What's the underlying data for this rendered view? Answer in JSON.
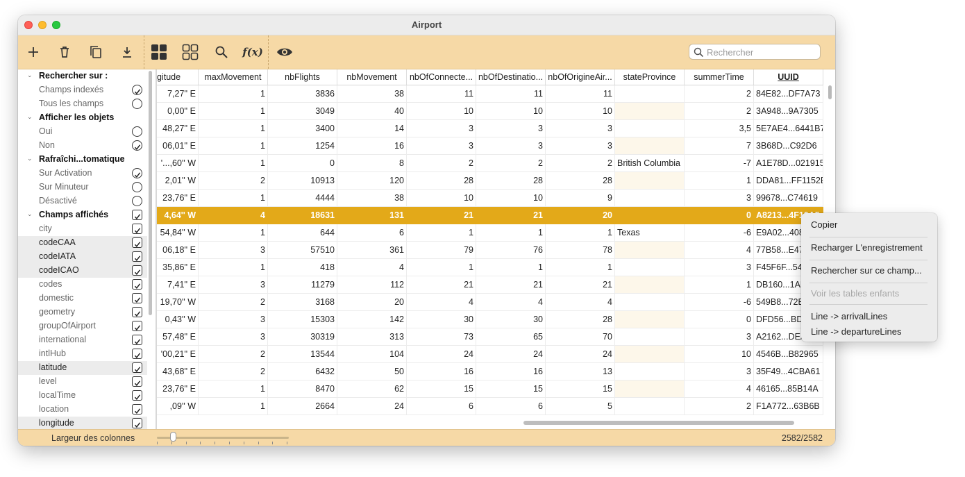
{
  "window": {
    "title": "Airport"
  },
  "toolbar": {
    "icons": [
      "plus-icon",
      "trash-icon",
      "duplicate-icon",
      "download-icon",
      "grid-view-icon",
      "grid-outline-icon",
      "magnifier-icon",
      "function-icon",
      "eye-icon"
    ],
    "search_placeholder": "Rechercher",
    "function_label": "f(x)"
  },
  "sidebar": {
    "sections": [
      {
        "title": "Rechercher sur :",
        "items": [
          {
            "label": "Champs indexés",
            "type": "radio",
            "checked": true
          },
          {
            "label": "Tous les champs",
            "type": "radio",
            "checked": false
          }
        ]
      },
      {
        "title": "Afficher les objets",
        "items": [
          {
            "label": "Oui",
            "type": "radio",
            "checked": false
          },
          {
            "label": "Non",
            "type": "radio",
            "checked": true
          }
        ]
      },
      {
        "title": "Rafraîchi...tomatique",
        "items": [
          {
            "label": "Sur Activation",
            "type": "radio",
            "checked": true
          },
          {
            "label": "Sur Minuteur",
            "type": "radio",
            "checked": false
          },
          {
            "label": "Désactivé",
            "type": "radio",
            "checked": false
          }
        ]
      },
      {
        "title": "Champs affichés",
        "checkbox": true,
        "items": [
          {
            "label": "city",
            "type": "check",
            "checked": true
          },
          {
            "label": "codeCAA",
            "type": "check",
            "checked": true,
            "highlight": true
          },
          {
            "label": "codeIATA",
            "type": "check",
            "checked": true,
            "highlight": true
          },
          {
            "label": "codeICAO",
            "type": "check",
            "checked": true,
            "highlight": true
          },
          {
            "label": "codes",
            "type": "check",
            "checked": true
          },
          {
            "label": "domestic",
            "type": "check",
            "checked": true
          },
          {
            "label": "geometry",
            "type": "check",
            "checked": true
          },
          {
            "label": "groupOfAirport",
            "type": "check",
            "checked": true
          },
          {
            "label": "international",
            "type": "check",
            "checked": true
          },
          {
            "label": "intlHub",
            "type": "check",
            "checked": true
          },
          {
            "label": "latitude",
            "type": "check",
            "checked": true,
            "highlight": true
          },
          {
            "label": "level",
            "type": "check",
            "checked": true
          },
          {
            "label": "localTime",
            "type": "check",
            "checked": true
          },
          {
            "label": "location",
            "type": "check",
            "checked": true
          },
          {
            "label": "longitude",
            "type": "check",
            "checked": true,
            "highlight": true
          }
        ]
      }
    ]
  },
  "table": {
    "columns": [
      "gitude",
      "maxMovement",
      "nbFlights",
      "nbMovement",
      "nbOfConnecte...",
      "nbOfDestinatio...",
      "nbOfOrigineAir...",
      "stateProvince",
      "summerTime",
      "UUID"
    ],
    "sorted_column": "UUID",
    "selected_row": 7,
    "rows": [
      [
        "7,27'' E",
        "1",
        "3836",
        "38",
        "11",
        "11",
        "11",
        "",
        "2",
        "84E82...DF7A73"
      ],
      [
        "0,00'' E",
        "1",
        "3049",
        "40",
        "10",
        "10",
        "10",
        "",
        "2",
        "3A948...9A7305"
      ],
      [
        "48,27'' E",
        "1",
        "3400",
        "14",
        "3",
        "3",
        "3",
        "",
        "3,5",
        "5E7AE4...6441B7"
      ],
      [
        "06,01'' E",
        "1",
        "1254",
        "16",
        "3",
        "3",
        "3",
        "",
        "7",
        "3B68D...C92D6"
      ],
      [
        "'...,60'' W",
        "1",
        "0",
        "8",
        "2",
        "2",
        "2",
        "British Columbia",
        "-7",
        "A1E78D...021915"
      ],
      [
        "2,01'' W",
        "2",
        "10913",
        "120",
        "28",
        "28",
        "28",
        "",
        "1",
        "DDA81...FF1152E"
      ],
      [
        "23,76'' E",
        "1",
        "4444",
        "38",
        "10",
        "10",
        "9",
        "",
        "3",
        "99678...C74619"
      ],
      [
        "4,64'' W",
        "4",
        "18631",
        "131",
        "21",
        "21",
        "20",
        "",
        "0",
        "A8213...4F10A5"
      ],
      [
        "54,84'' W",
        "1",
        "644",
        "6",
        "1",
        "1",
        "1",
        "Texas",
        "-6",
        "E9A02...408"
      ],
      [
        "06,18'' E",
        "3",
        "57510",
        "361",
        "79",
        "76",
        "78",
        "",
        "4",
        "77B58...E47"
      ],
      [
        "35,86'' E",
        "1",
        "418",
        "4",
        "1",
        "1",
        "1",
        "",
        "3",
        "F45F6F...54"
      ],
      [
        "7,41'' E",
        "3",
        "11279",
        "112",
        "21",
        "21",
        "21",
        "",
        "1",
        "DB160...1AE"
      ],
      [
        "19,70'' W",
        "2",
        "3168",
        "20",
        "4",
        "4",
        "4",
        "",
        "-6",
        "549B8...72E"
      ],
      [
        "0,43'' W",
        "3",
        "15303",
        "142",
        "30",
        "30",
        "28",
        "",
        "0",
        "DFD56...BD"
      ],
      [
        "57,48'' E",
        "3",
        "30319",
        "313",
        "73",
        "65",
        "70",
        "",
        "3",
        "A2162...DEA"
      ],
      [
        "'00,21'' E",
        "2",
        "13544",
        "104",
        "24",
        "24",
        "24",
        "",
        "10",
        "4546B...B82965"
      ],
      [
        "43,68'' E",
        "2",
        "6432",
        "50",
        "16",
        "16",
        "13",
        "",
        "3",
        "35F49...4CBA61"
      ],
      [
        "23,76'' E",
        "1",
        "8470",
        "62",
        "15",
        "15",
        "15",
        "",
        "4",
        "46165...85B14A"
      ],
      [
        ",09'' W",
        "1",
        "2664",
        "24",
        "6",
        "6",
        "5",
        "",
        "2",
        "F1A772...63B6B"
      ]
    ]
  },
  "status": {
    "column_width_label": "Largeur des colonnes",
    "count": "2582/2582"
  },
  "context_menu": {
    "items": [
      {
        "label": "Copier",
        "disabled": false
      },
      {
        "label": "Recharger L'enregistrement",
        "disabled": false
      },
      {
        "label": "Rechercher sur ce champ...",
        "disabled": false
      },
      {
        "label": "Voir les tables enfants",
        "disabled": true
      },
      {
        "label": "Line -> arrivalLines",
        "disabled": false
      },
      {
        "label": "Line -> departureLines",
        "disabled": false
      }
    ]
  },
  "colors": {
    "accent": "#f6d9a6",
    "selection": "#e3a919",
    "alt_row": "#fdf7ea"
  }
}
